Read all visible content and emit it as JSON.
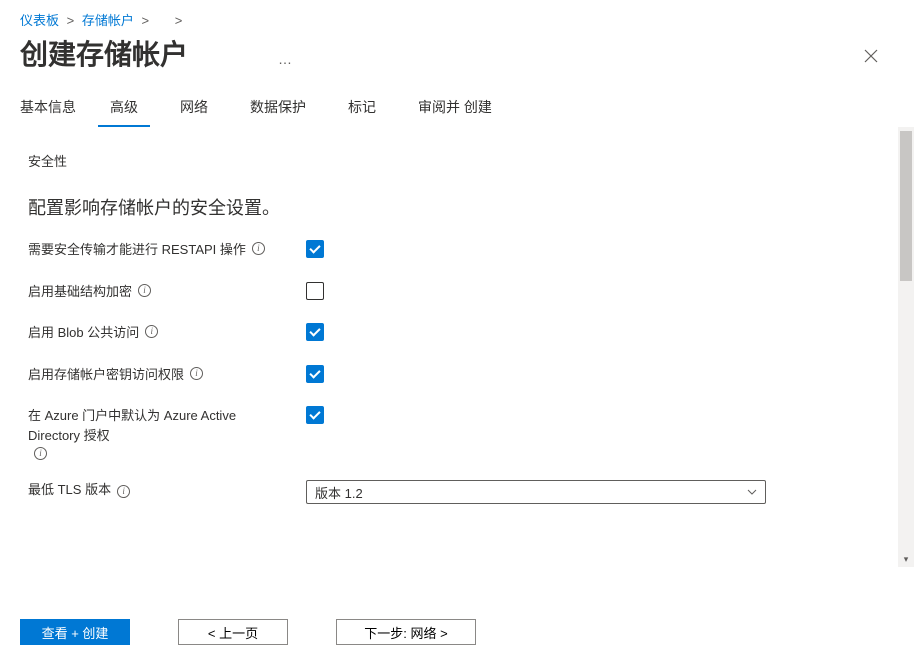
{
  "breadcrumb": {
    "item1": "仪表板",
    "item2": "存储帐户",
    "sep": ">"
  },
  "page_title": "创建存储帐户",
  "ellipsis": "…",
  "tabs": {
    "basic": "基本信息",
    "advanced": "高级",
    "network": "网络",
    "data_protection": "数据保护",
    "tags": "标记",
    "review": "审阅并 创建"
  },
  "section": {
    "security_label": "安全性",
    "security_desc": "配置影响存储帐户的安全设置。"
  },
  "fields": {
    "secure_transfer": "需要安全传输才能进行 RESTAPI 操作",
    "infra_encryption": "启用基础结构加密",
    "blob_public": "启用 Blob 公共访问",
    "key_access": "启用存储帐户密钥访问权限",
    "aad_default": "在 Azure 门户中默认为 Azure Active Directory 授权",
    "min_tls": "最低 TLS 版本"
  },
  "tls_select": {
    "value": "版本 1.2"
  },
  "footer": {
    "review_create": "查看 + 创建",
    "prev": "< 上一页",
    "next": "下一步: 网络    >"
  }
}
